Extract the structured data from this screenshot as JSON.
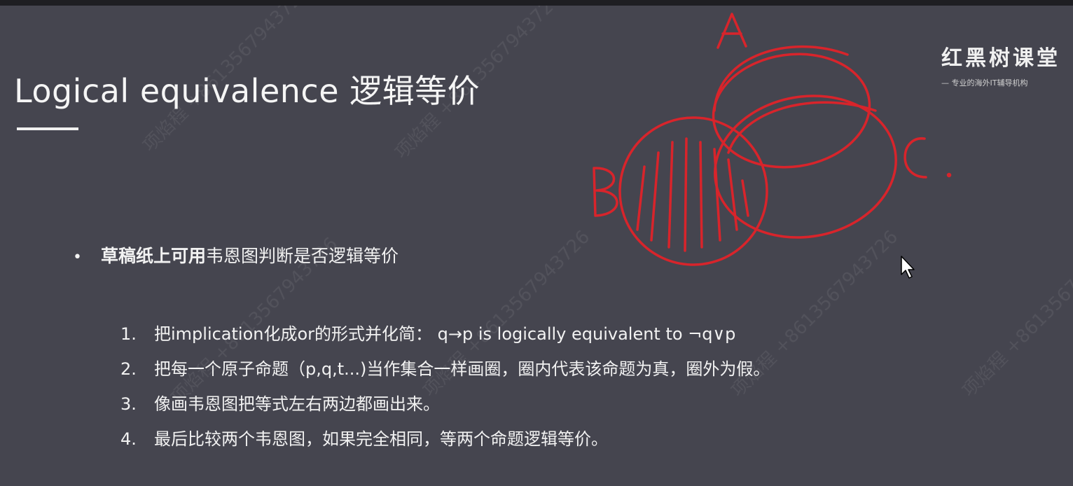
{
  "slide": {
    "title": "Logical equivalence 逻辑等价",
    "brand": {
      "name": "红黑树课堂",
      "tagline": "— 专业的海外IT辅导机构"
    },
    "bullet": {
      "bold_text": "草稿纸上可用",
      "text": "韦恩图判断是否逻辑等价"
    },
    "steps": [
      {
        "num": "1.",
        "text": "把implication化成or的形式并化简： q→p is logically equivalent to ¬q∨p"
      },
      {
        "num": "2.",
        "text": "把每一个原子命题（p,q,t...)当作集合一样画圈，圈内代表该命题为真，圈外为假。"
      },
      {
        "num": "3.",
        "text": "像画韦恩图把等式左右两边都画出来。"
      },
      {
        "num": "4.",
        "text": "最后比较两个韦恩图，如果完全相同，等两个命题逻辑等价。"
      }
    ]
  },
  "annotation": {
    "labels": [
      "A",
      "B",
      "C"
    ],
    "ink_color": "#d8242b"
  },
  "watermarks": [
    "项焰程 +8613567943726"
  ]
}
